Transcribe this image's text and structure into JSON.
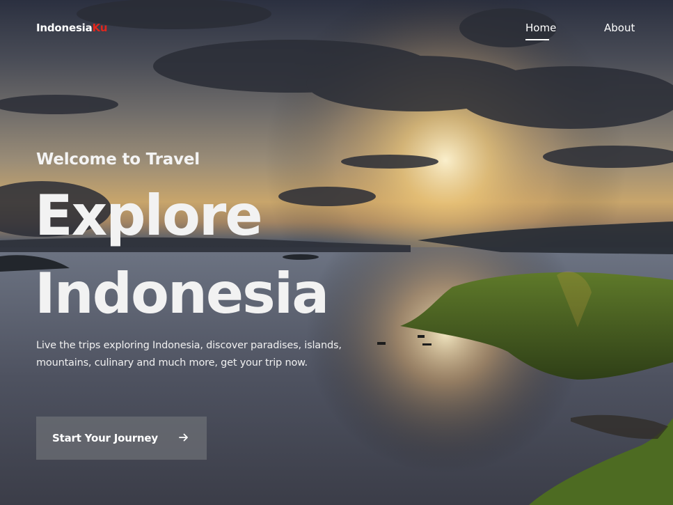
{
  "brand": {
    "name": "Indonesia",
    "accent": "Ku",
    "accent_color": "#e1261c"
  },
  "nav": {
    "items": [
      {
        "label": "Home",
        "active": true
      },
      {
        "label": "About",
        "active": false
      }
    ]
  },
  "hero": {
    "welcome": "Welcome to Travel",
    "headline_line1": "Explore",
    "headline_line2": "Indonesia",
    "description": "Live the trips exploring Indonesia, discover paradises, islands, mountains, culinary and much more, get your trip now.",
    "cta_label": "Start Your Journey",
    "cta_icon": "arrow-right-icon"
  }
}
